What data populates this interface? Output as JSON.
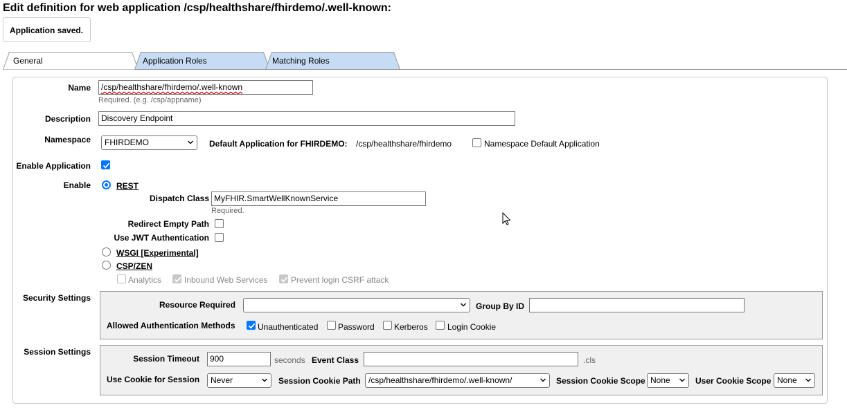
{
  "page_title": "Edit definition for web application /csp/healthshare/fhirdemo/.well-known:",
  "status_message": "Application saved.",
  "tabs": [
    {
      "label": "General",
      "active": true
    },
    {
      "label": "Application Roles",
      "active": false
    },
    {
      "label": "Matching Roles",
      "active": false
    }
  ],
  "general": {
    "name_label": "Name",
    "name_value": "/csp/healthshare/fhirdemo/.well-known",
    "name_hint": "Required. (e.g. /csp/appname)",
    "description_label": "Description",
    "description_value": "Discovery Endpoint",
    "namespace_label": "Namespace",
    "namespace_value": "FHIRDEMO",
    "default_app_label": "Default Application for FHIRDEMO:",
    "default_app_value": "/csp/healthshare/fhirdemo",
    "ns_default_app_label": "Namespace Default Application",
    "ns_default_app_checked": false,
    "enable_application_label": "Enable Application",
    "enable_application_checked": true,
    "enable_label": "Enable",
    "rest_label": "REST",
    "rest_selected": true,
    "dispatch_class_label": "Dispatch Class",
    "dispatch_class_value": "MyFHIR.SmartWellKnownService",
    "dispatch_class_hint": "Required.",
    "redirect_empty_path_label": "Redirect Empty Path",
    "redirect_empty_path_checked": false,
    "use_jwt_label": "Use JWT Authentication",
    "use_jwt_checked": false,
    "wsgi_label": "WSGI [Experimental]",
    "wsgi_selected": false,
    "cspzen_label": "CSP/ZEN",
    "cspzen_selected": false,
    "analytics_label": "Analytics",
    "analytics_checked": false,
    "inbound_ws_label": "Inbound Web Services",
    "inbound_ws_checked": true,
    "prevent_csrf_label": "Prevent login CSRF attack",
    "prevent_csrf_checked": true
  },
  "security": {
    "section_label": "Security Settings",
    "resource_required_label": "Resource Required",
    "resource_required_value": "",
    "group_by_id_label": "Group By ID",
    "group_by_id_value": "",
    "auth_methods_label": "Allowed Authentication Methods",
    "auth_methods": [
      {
        "label": "Unauthenticated",
        "checked": true
      },
      {
        "label": "Password",
        "checked": false
      },
      {
        "label": "Kerberos",
        "checked": false
      },
      {
        "label": "Login Cookie",
        "checked": false
      }
    ]
  },
  "session": {
    "section_label": "Session Settings",
    "timeout_label": "Session Timeout",
    "timeout_value": "900",
    "timeout_unit": "seconds",
    "event_class_label": "Event Class",
    "event_class_value": "",
    "event_class_suffix": ".cls",
    "use_cookie_label": "Use Cookie for Session",
    "use_cookie_value": "Never",
    "cookie_path_label": "Session Cookie Path",
    "cookie_path_value": "/csp/healthshare/fhirdemo/.well-known/",
    "cookie_scope_label": "Session Cookie Scope",
    "cookie_scope_value": "None",
    "user_cookie_scope_label": "User Cookie Scope",
    "user_cookie_scope_value": "None"
  },
  "colors": {
    "tab_inactive_bg": "#c6dcf5",
    "checkbox_accent": "#0075ff",
    "section_bg": "#f0f0f0"
  }
}
